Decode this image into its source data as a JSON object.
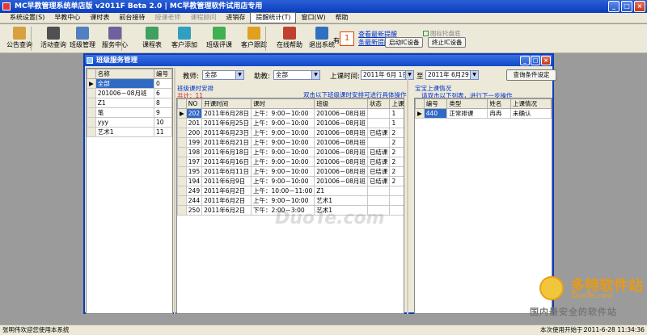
{
  "window": {
    "title": "MC早教管理系统单店版 v2011F Beta 2.0  | MC早教管理软件试用店专用"
  },
  "menu": [
    {
      "label": "系统设置(S)",
      "disabled": false
    },
    {
      "label": "早教中心",
      "disabled": false
    },
    {
      "label": "课时表",
      "disabled": false
    },
    {
      "label": "前台接待",
      "disabled": false
    },
    {
      "label": "授课老师",
      "disabled": true
    },
    {
      "label": "课程顾问",
      "disabled": true
    },
    {
      "label": "进销存",
      "disabled": false
    },
    {
      "label": "提醒统计(T)",
      "disabled": false,
      "boxed": true
    },
    {
      "label": "窗口(W)",
      "disabled": false
    },
    {
      "label": "帮助",
      "disabled": false
    }
  ],
  "toolbar": [
    {
      "label": "公告查询",
      "icon": "notice-icon",
      "color": "#d8a040"
    },
    {
      "label": "活动查询",
      "icon": "activity-icon",
      "color": "#505050"
    },
    {
      "label": "班级管理",
      "icon": "class-icon",
      "color": "#5080c0"
    },
    {
      "label": "服务中心",
      "icon": "service-icon",
      "color": "#7060a0"
    },
    {
      "label": "课程表",
      "icon": "schedule-icon",
      "color": "#40a060"
    },
    {
      "label": "客户添加",
      "icon": "customer-add-icon",
      "color": "#30a0c0"
    },
    {
      "label": "班级评课",
      "icon": "evaluate-icon",
      "color": "#40b050"
    },
    {
      "label": "客户跟踪",
      "icon": "track-icon",
      "color": "#e0a020"
    },
    {
      "label": "在线帮助",
      "icon": "help-icon",
      "color": "#c04030"
    },
    {
      "label": "退出系统",
      "icon": "exit-icon",
      "color": "#3070c0"
    }
  ],
  "notification": {
    "prefix": "有",
    "count": "1",
    "link1": "条最新提醒",
    "link2": "查看最新提醒",
    "start_ic": "启动IC设备",
    "stop_ic": "终止IC设备",
    "tray_label": "图标托盘底"
  },
  "child_window": {
    "title": "班级服务管理"
  },
  "left_table": {
    "headers": [
      "名称",
      "编号"
    ],
    "rows": [
      [
        "全部",
        "0"
      ],
      [
        "201006－08月班",
        "6"
      ],
      [
        "Z1",
        "8"
      ],
      [
        "笔",
        "9"
      ],
      [
        "yyy",
        "10"
      ],
      [
        "艺术1",
        "11"
      ]
    ]
  },
  "filter": {
    "teacher_label": "教师:",
    "teacher_value": "全部",
    "assistant_label": "助教:",
    "assistant_value": "全部",
    "time_label": "上课时间:",
    "date_from": "2011年 6月 1日",
    "to_label": "至",
    "date_to": "2011年 6月29日",
    "query_button": "查询条件设定"
  },
  "middle": {
    "section_title": "班级课时安排",
    "count_text": "共计：11",
    "hint": "双击以下班级课时安排可进行具体操作",
    "headers": [
      "NO",
      "开课时间",
      "课时",
      "班级",
      "状态",
      "上课人数"
    ],
    "rows": [
      [
        "202",
        "2011年6月28日",
        "上午：9:00－10:00",
        "201006－08月班",
        "",
        "1"
      ],
      [
        "201",
        "2011年6月25日",
        "上午：9:00－10:00",
        "201006－08月班",
        "",
        "1"
      ],
      [
        "200",
        "2011年6月23日",
        "上午：9:00－10:00",
        "201006－08月班",
        "已结课",
        "2"
      ],
      [
        "199",
        "2011年6月21日",
        "上午：9:00－10:00",
        "201006－08月班",
        "",
        "2"
      ],
      [
        "198",
        "2011年6月18日",
        "上午：9:00－10:00",
        "201006－08月班",
        "已结课",
        "2"
      ],
      [
        "197",
        "2011年6月16日",
        "上午：9:00－10:00",
        "201006－08月班",
        "已结课",
        "2"
      ],
      [
        "195",
        "2011年6月11日",
        "上午：9:00－10:00",
        "201006－08月班",
        "已结课",
        "2"
      ],
      [
        "194",
        "2011年6月9日",
        "上午：9:00－10:00",
        "201006－08月班",
        "已结课",
        "2"
      ],
      [
        "249",
        "2011年6月2日",
        "上午：10:00－11:00",
        "Z1",
        "",
        ""
      ],
      [
        "244",
        "2011年6月2日",
        "上午：9:00－10:00",
        "艺术1",
        "",
        ""
      ],
      [
        "250",
        "2011年6月2日",
        "下午：2:00－3:00",
        "艺术1",
        "",
        ""
      ]
    ]
  },
  "right": {
    "section_title": "宝宝上课情况",
    "hint": "请双击以下列表，进行下一步操作",
    "headers": [
      "编号",
      "类型",
      "姓名",
      "上课情况"
    ],
    "rows": [
      [
        "440",
        "正常排课",
        "冉冉",
        "未确认"
      ]
    ]
  },
  "status": {
    "left": "张明伟欢迎您使用本系统",
    "right_label": "本次使用开始于：",
    "right_value": "2011-6-28 11:34:36"
  },
  "watermark": {
    "brand": "多特软件站",
    "domain": "DuoTe.com",
    "slogan": "国内最安全的软件站",
    "center": "DuoTe.com"
  }
}
